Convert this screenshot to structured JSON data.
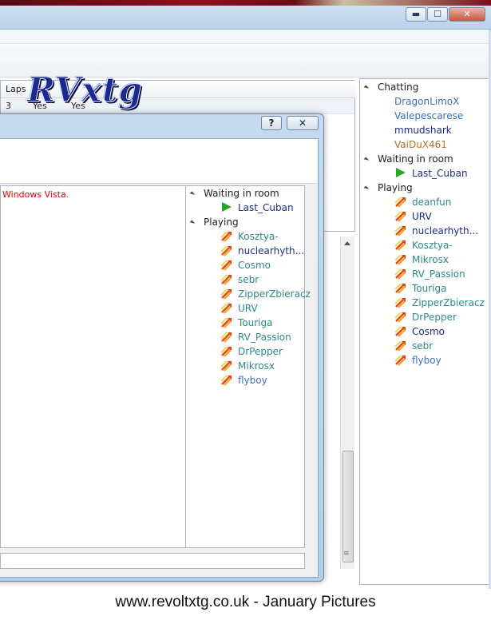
{
  "window": {
    "controls": {
      "minimize": "▬",
      "maximize": "☐",
      "close": "✕"
    }
  },
  "room_grid": {
    "headers": [
      "Laps",
      "",
      ""
    ],
    "row": [
      "3",
      "Yes",
      "Yes"
    ]
  },
  "watermark": {
    "text": "RVxtg"
  },
  "main_tree": {
    "groups": [
      {
        "label": "Chatting",
        "users": [
          {
            "name": "DragonLimoX",
            "color": "#3a6fc4",
            "icon": "none"
          },
          {
            "name": "Valepescarese",
            "color": "#3a6fc4",
            "icon": "none"
          },
          {
            "name": "mmudshark",
            "color": "#1b2b8c",
            "icon": "none"
          },
          {
            "name": "VaiDuX461",
            "color": "#b0702a",
            "icon": "none"
          }
        ]
      },
      {
        "label": "Waiting in room",
        "users": [
          {
            "name": "Last_Cuban",
            "color": "#1b2b8c",
            "icon": "play-icon"
          }
        ]
      },
      {
        "label": "Playing",
        "users": [
          {
            "name": "deanfun",
            "color": "#2b8a8a",
            "icon": "racing-icon"
          },
          {
            "name": "URV",
            "color": "#1b2b8c",
            "icon": "racing-icon"
          },
          {
            "name": "nuclearhyth...",
            "color": "#1b2b8c",
            "icon": "racing-icon"
          },
          {
            "name": "Kosztya-",
            "color": "#2b8a8a",
            "icon": "racing-icon"
          },
          {
            "name": "Mikrosx",
            "color": "#2b8a8a",
            "icon": "racing-icon"
          },
          {
            "name": "RV_Passion",
            "color": "#2b8a8a",
            "icon": "racing-icon"
          },
          {
            "name": "Touriga",
            "color": "#2b8a8a",
            "icon": "racing-icon"
          },
          {
            "name": "ZipperZbieracz",
            "color": "#2b8a8a",
            "icon": "racing-icon"
          },
          {
            "name": "DrPepper",
            "color": "#2b8a8a",
            "icon": "racing-icon"
          },
          {
            "name": "Cosmo",
            "color": "#1b2b8c",
            "icon": "racing-icon"
          },
          {
            "name": "sebr",
            "color": "#2b8a8a",
            "icon": "racing-icon"
          },
          {
            "name": "flyboy",
            "color": "#3a6fc4",
            "icon": "racing-icon"
          }
        ]
      }
    ]
  },
  "dialog": {
    "buttons": {
      "help": "?",
      "close": "✕"
    },
    "chat_message": "Windows Vista.",
    "tree": {
      "groups": [
        {
          "label": "Waiting in room",
          "users": [
            {
              "name": "Last_Cuban",
              "color": "#1b2b8c",
              "icon": "play-icon"
            }
          ]
        },
        {
          "label": "Playing",
          "users": [
            {
              "name": "Kosztya-",
              "color": "#2b8a8a",
              "icon": "racing-icon"
            },
            {
              "name": "nuclearhyth...",
              "color": "#1b2b8c",
              "icon": "racing-icon"
            },
            {
              "name": "Cosmo",
              "color": "#2b8a8a",
              "icon": "racing-icon"
            },
            {
              "name": "sebr",
              "color": "#2b8a8a",
              "icon": "racing-icon"
            },
            {
              "name": "ZipperZbieracz",
              "color": "#2b8a8a",
              "icon": "racing-icon"
            },
            {
              "name": "URV",
              "color": "#2b8a8a",
              "icon": "racing-icon"
            },
            {
              "name": "Touriga",
              "color": "#2b8a8a",
              "icon": "racing-icon"
            },
            {
              "name": "RV_Passion",
              "color": "#2b8a8a",
              "icon": "racing-icon"
            },
            {
              "name": "DrPepper",
              "color": "#2b8a8a",
              "icon": "racing-icon"
            },
            {
              "name": "Mikrosx",
              "color": "#2b8a8a",
              "icon": "racing-icon"
            },
            {
              "name": "flyboy",
              "color": "#3a6fc4",
              "icon": "racing-icon"
            }
          ]
        }
      ]
    }
  },
  "caption": "www.revoltxtg.co.uk - January Pictures"
}
